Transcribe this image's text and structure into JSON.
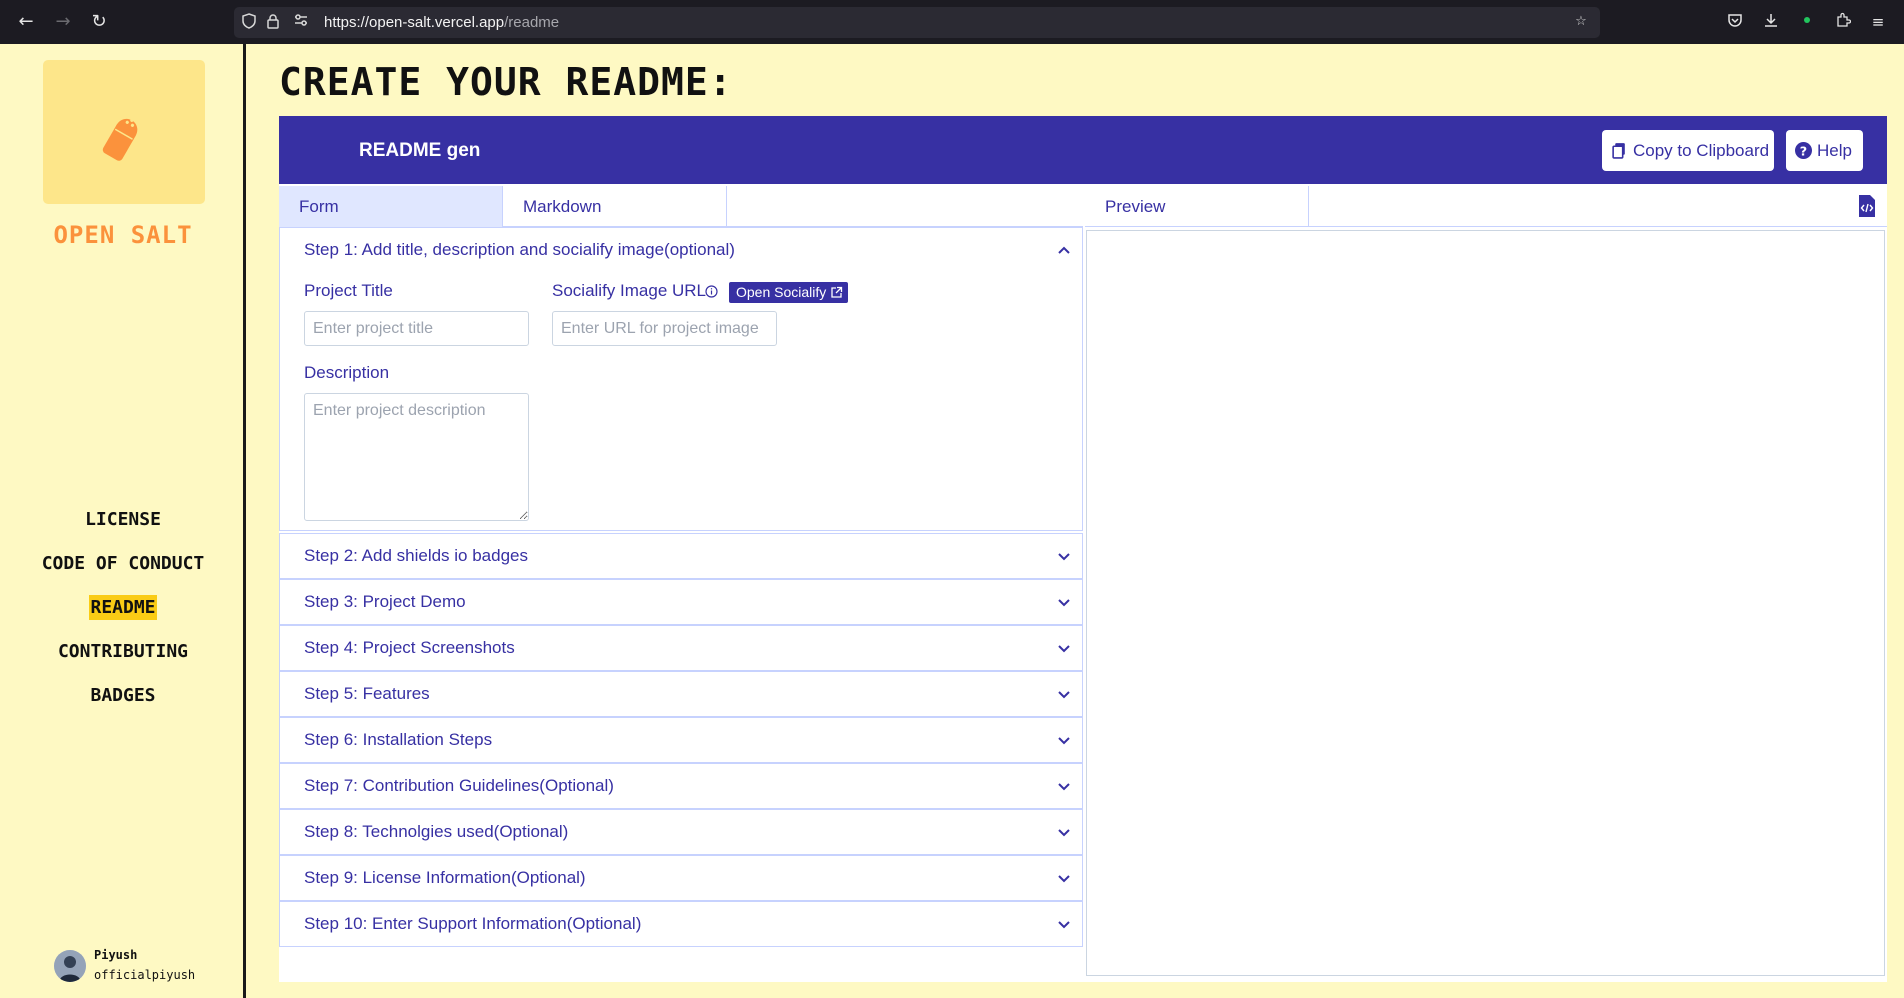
{
  "browser": {
    "url_host": "https://open-salt.vercel.app",
    "url_path": "/readme"
  },
  "sidebar": {
    "brand": "OPEN SALT",
    "nav": [
      {
        "label": "LICENSE",
        "active": false
      },
      {
        "label": "CODE OF CONDUCT",
        "active": false
      },
      {
        "label": "README",
        "active": true
      },
      {
        "label": "CONTRIBUTING",
        "active": false
      },
      {
        "label": "BADGES",
        "active": false
      }
    ],
    "user": {
      "name": "Piyush",
      "handle": "officialpiyush"
    }
  },
  "main": {
    "title": "CREATE YOUR README:",
    "header_title": "README gen",
    "copy_label": "Copy to Clipboard",
    "help_label": "Help",
    "tabs": [
      "Form",
      "Markdown"
    ],
    "active_tab": "Form",
    "preview_tab": "Preview"
  },
  "form": {
    "step1": {
      "title": "Step 1: Add title, description and socialify image(optional)",
      "project_title_label": "Project Title",
      "project_title_placeholder": "Enter project title",
      "socialify_label": "Socialify Image URL",
      "socialify_placeholder": "Enter URL for project image",
      "open_socialify": "Open Socialify",
      "description_label": "Description",
      "description_placeholder": "Enter project description"
    },
    "steps": [
      "Step 2: Add shields io badges",
      "Step 3: Project Demo",
      "Step 4: Project Screenshots",
      "Step 5: Features",
      "Step 6: Installation Steps",
      "Step 7: Contribution Guidelines(Optional)",
      "Step 8: Technolgies used(Optional)",
      "Step 9: License Information(Optional)",
      "Step 10: Enter Support Information(Optional)"
    ]
  },
  "colors": {
    "background": "#fef9c3",
    "brand_orange": "#fb923c",
    "primary": "#3730a3",
    "highlight": "#facc15"
  }
}
